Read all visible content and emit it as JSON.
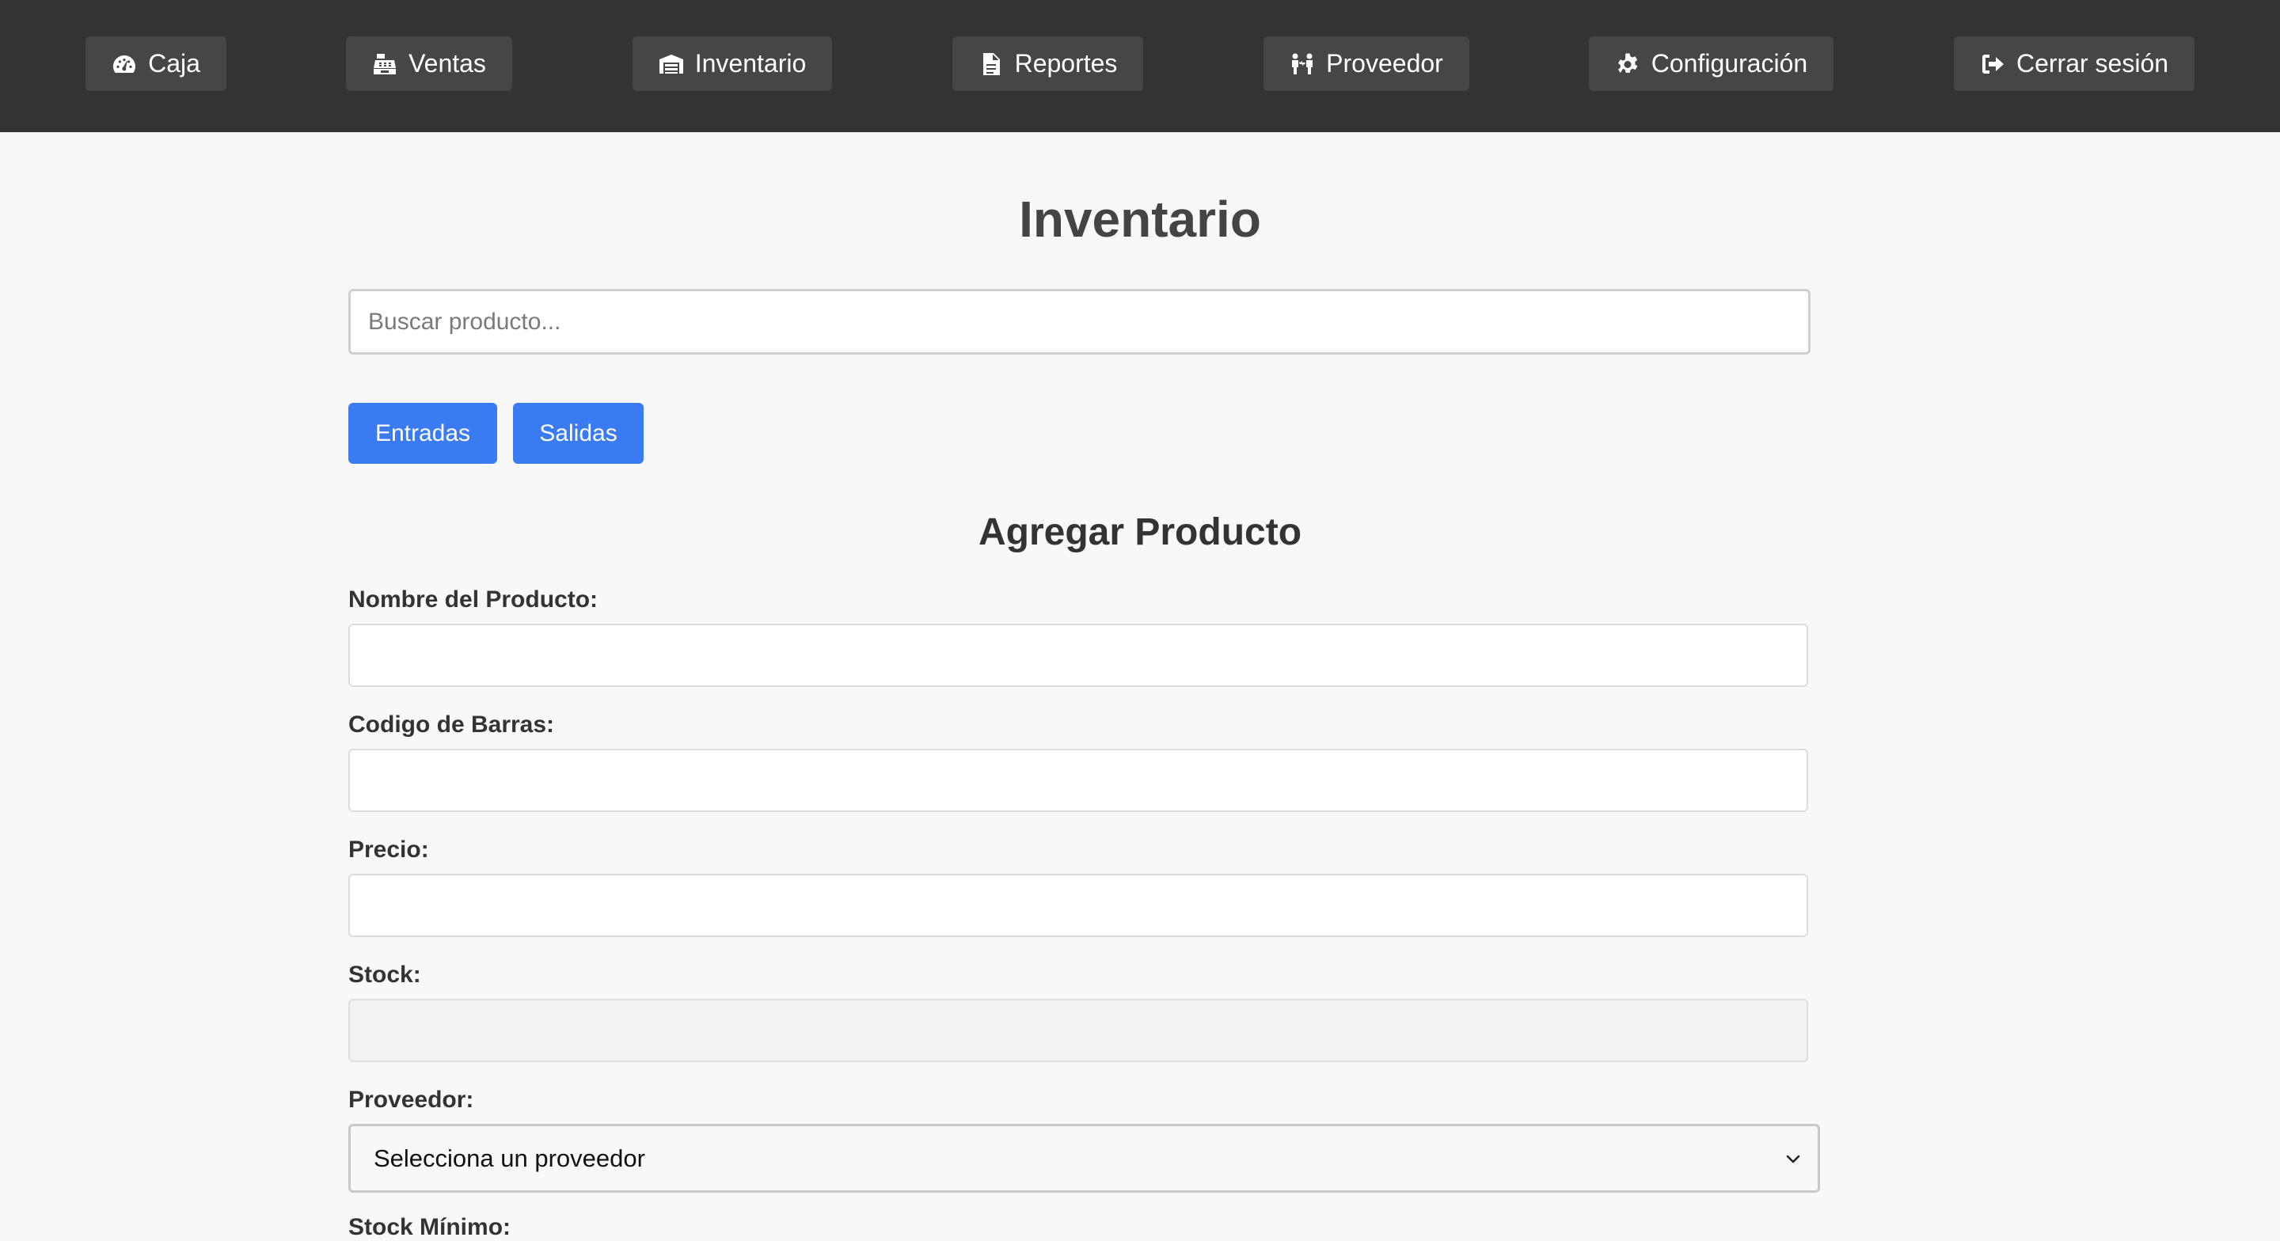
{
  "nav": {
    "items": [
      {
        "label": "Caja",
        "icon": "gauge-icon"
      },
      {
        "label": "Ventas",
        "icon": "cash-register-icon"
      },
      {
        "label": "Inventario",
        "icon": "warehouse-icon"
      },
      {
        "label": "Reportes",
        "icon": "file-report-icon"
      },
      {
        "label": "Proveedor",
        "icon": "people-exchange-icon"
      },
      {
        "label": "Configuración",
        "icon": "gear-icon"
      },
      {
        "label": "Cerrar sesión",
        "icon": "logout-icon"
      }
    ]
  },
  "page": {
    "title": "Inventario"
  },
  "search": {
    "placeholder": "Buscar producto...",
    "value": ""
  },
  "actions": {
    "entradas": "Entradas",
    "salidas": "Salidas"
  },
  "form": {
    "title": "Agregar Producto",
    "fields": {
      "nombre": {
        "label": "Nombre del Producto:",
        "value": ""
      },
      "codigo": {
        "label": "Codigo de Barras:",
        "value": ""
      },
      "precio": {
        "label": "Precio:",
        "value": ""
      },
      "stock": {
        "label": "Stock:",
        "value": ""
      }
    },
    "proveedor": {
      "label": "Proveedor:",
      "selected": "Selecciona un proveedor"
    },
    "stock_min_label": "Stock Mínimo:"
  },
  "colors": {
    "navbar": "#333333",
    "nav_button": "#464646",
    "primary": "#3a7bf2",
    "background": "#f8f8f8"
  }
}
